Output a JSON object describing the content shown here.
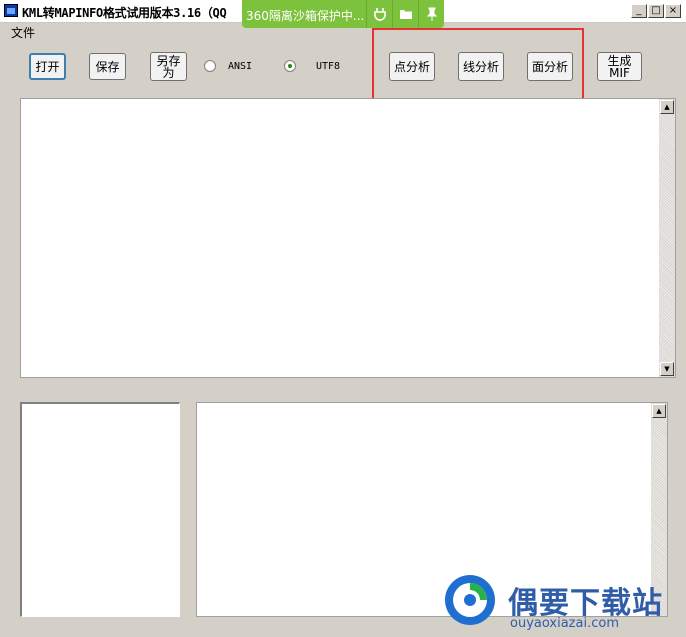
{
  "window": {
    "title": "KML转MAPINFO格式试用版本3.16（QQ",
    "controls": {
      "minimize": "_",
      "maximize": "□",
      "close": "×"
    }
  },
  "sandbox_bar": {
    "text": "360隔离沙箱保护中...",
    "icons": [
      "plug-icon",
      "folder-icon",
      "pin-icon"
    ]
  },
  "menu": {
    "file": "文件"
  },
  "toolbar": {
    "open": "打开",
    "save": "保存",
    "save_as": "另存为",
    "encoding": {
      "ansi": "ANSI",
      "utf8": "UTF8",
      "selected": "UTF8"
    },
    "point_analysis": "点分析",
    "line_analysis": "线分析",
    "area_analysis": "面分析",
    "generate_mif": "生成MIF"
  },
  "scroll": {
    "up": "▲",
    "down": "▼"
  },
  "watermark": {
    "name": "偶要下载站",
    "url": "ouyaoxiazai.com"
  },
  "colors": {
    "highlight": "#e53232",
    "sandbox": "#7dc23c",
    "brand": "#2f5da8"
  }
}
